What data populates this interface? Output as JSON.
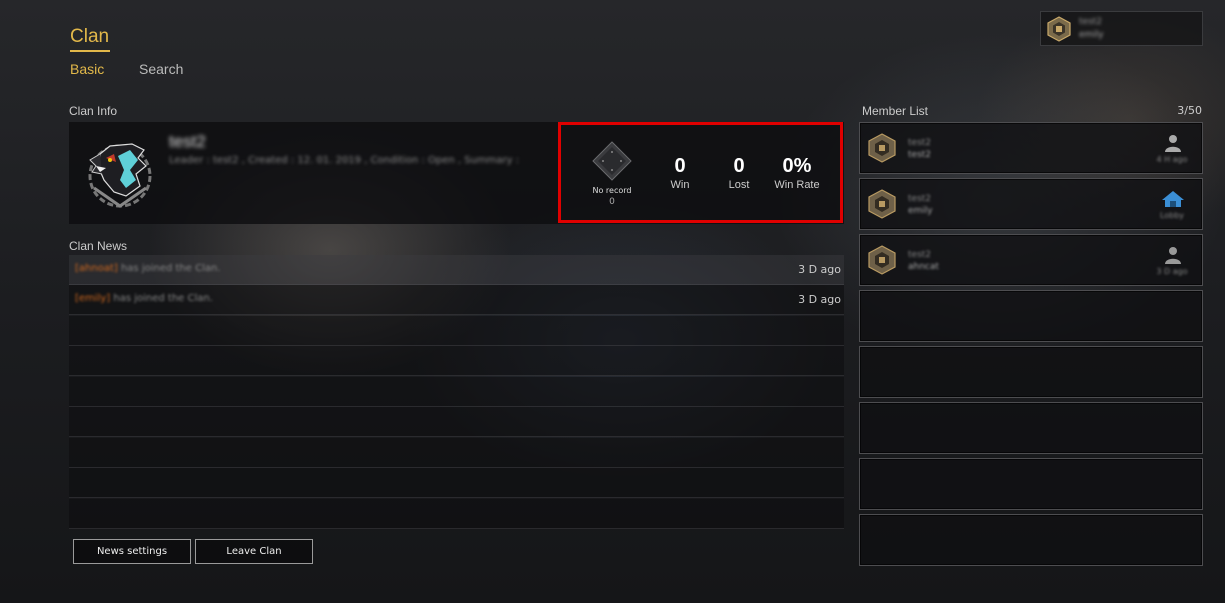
{
  "header": {
    "title": "Clan",
    "tabs": [
      {
        "label": "Basic",
        "active": true
      },
      {
        "label": "Search",
        "active": false
      }
    ]
  },
  "profile": {
    "name": "test2",
    "sub": "emily"
  },
  "clan_info": {
    "label": "Clan Info",
    "name": "test2",
    "details": "Leader : test2 , Created : 12. 01. 2019 , Condition : Open , Summary :",
    "record": {
      "rank_label": "No record",
      "rank_value": "0",
      "win_value": "0",
      "win_label": "Win",
      "lost_value": "0",
      "lost_label": "Lost",
      "rate_value": "0%",
      "rate_label": "Win Rate"
    }
  },
  "news": {
    "label": "Clan News",
    "items": [
      {
        "name": "[ahnoat]",
        "message": "has joined the Clan.",
        "time": "3 D ago"
      },
      {
        "name": "[emily]",
        "message": "has joined the Clan.",
        "time": "3 D ago"
      }
    ]
  },
  "buttons": {
    "news_settings": "News settings",
    "leave_clan": "Leave Clan"
  },
  "members": {
    "label": "Member List",
    "count": "3/50",
    "items": [
      {
        "name": "test2",
        "sub": "test2",
        "status": "4 H ago",
        "status_icon": "user-icon"
      },
      {
        "name": "test2",
        "sub": "emily",
        "status": "Lobby",
        "status_icon": "home-icon"
      },
      {
        "name": "test2",
        "sub": "ahncat",
        "status": "3 D ago",
        "status_icon": "user-icon"
      }
    ]
  },
  "colors": {
    "accent": "#e2b84a",
    "highlight_border": "#e00000",
    "news_name": "#d2691e",
    "lobby_icon": "#3b8fd6"
  }
}
